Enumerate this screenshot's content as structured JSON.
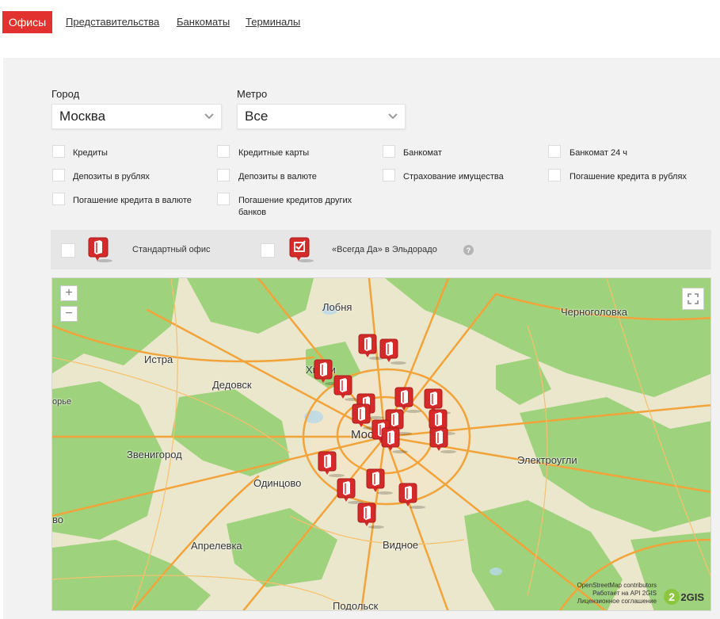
{
  "tabs": {
    "active": "Офисы",
    "links": [
      "Представительства",
      "Банкоматы",
      "Терминалы"
    ]
  },
  "filters": {
    "city_label": "Город",
    "city_value": "Москва",
    "metro_label": "Метро",
    "metro_value": "Все",
    "checkboxes": [
      "Кредиты",
      "Кредитные карты",
      "Банкомат",
      "Банкомат 24 ч",
      "Депозиты в рублях",
      "Депозиты в валюте",
      "Страхование имущества",
      "Погашение кредита в рублях",
      "Погашение кредита в валюте",
      "Погашение кредитов других банков"
    ]
  },
  "legend": {
    "standard_office": "Стандартный офис",
    "eldorado": "«Всегда Да» в Эльдорадо",
    "help_icon": "?"
  },
  "map": {
    "zoom_in": "+",
    "zoom_out": "−",
    "cities": [
      "Лобня",
      "Черноголовка",
      "Истра",
      "Химки",
      "Дедовск",
      "Москва",
      "Звенигород",
      "Электроугли",
      "Одинцово",
      "Апрелевка",
      "Видное",
      "Подольск",
      "орье",
      "во"
    ],
    "attribution": [
      "OpenStreetMap contributors",
      "Работает на API 2GIS",
      "Лицензионное соглашение"
    ],
    "logo": "2GIS",
    "office_markers": 21
  },
  "colors": {
    "accent": "#e1322f",
    "panel": "#f2f2f2",
    "map_road": "#f3a83a",
    "map_forest": "#9ed27a"
  }
}
